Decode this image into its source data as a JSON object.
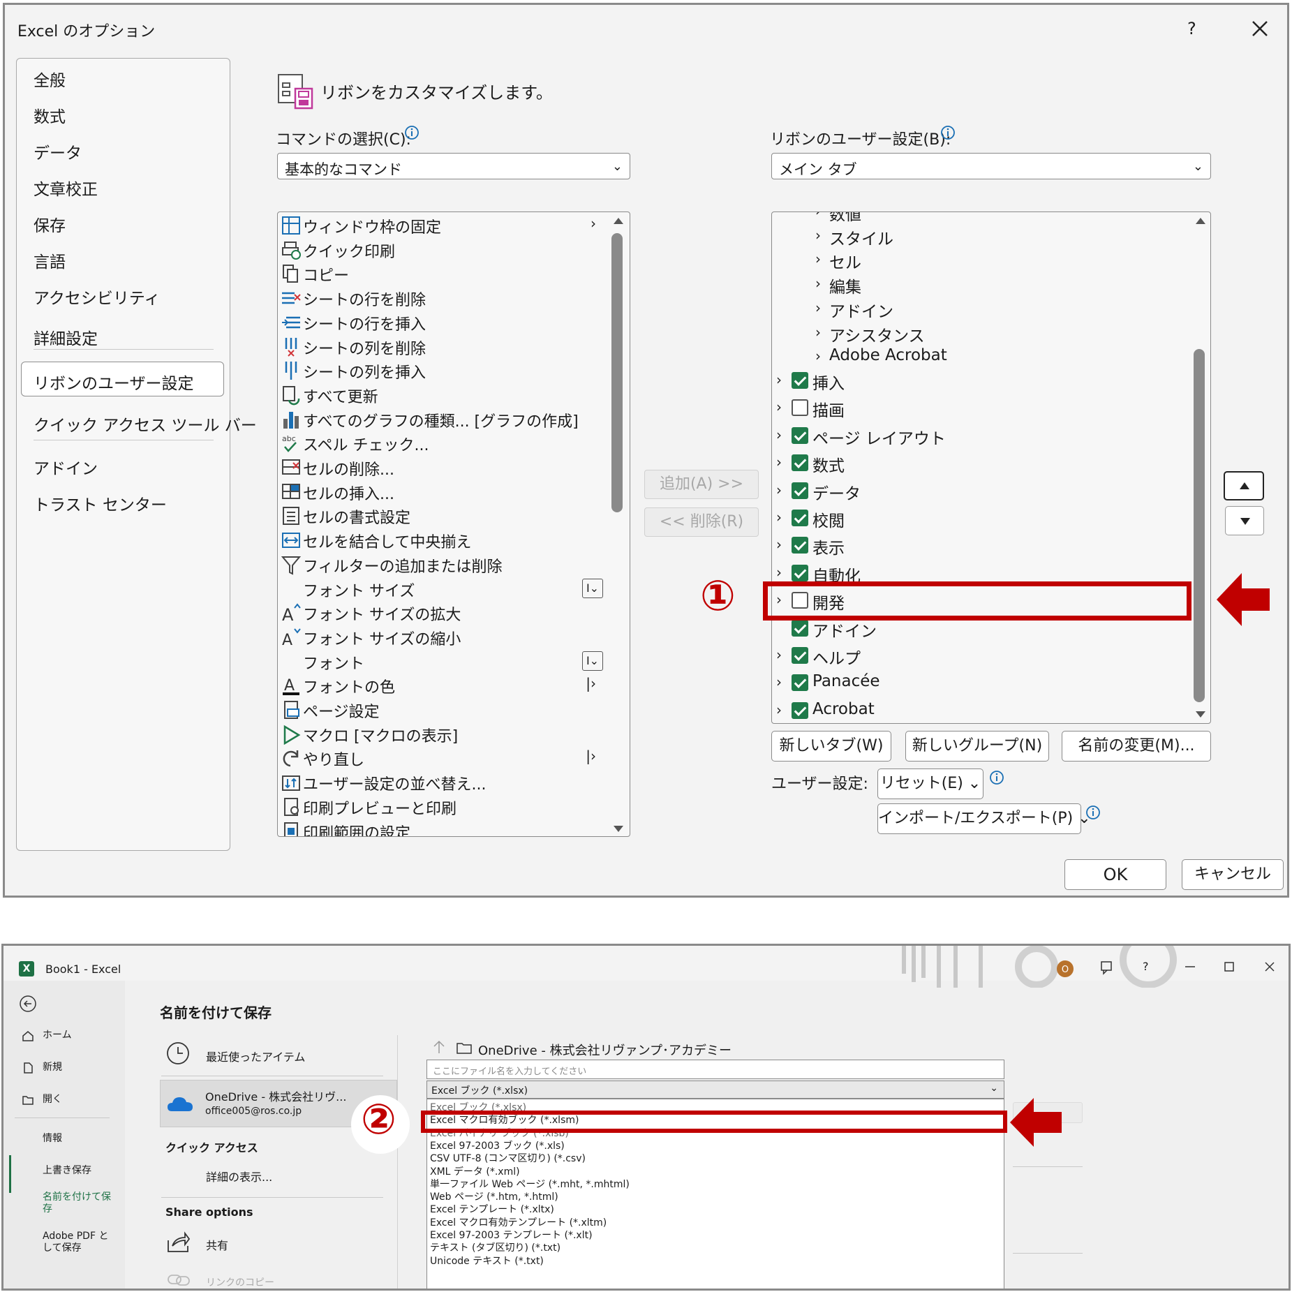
{
  "dialog": {
    "title": "Excel のオプション",
    "help": "?",
    "nav": [
      "全般",
      "数式",
      "データ",
      "文章校正",
      "保存",
      "言語",
      "アクセシビリティ",
      "詳細設定",
      "リボンのユーザー設定",
      "クイック アクセス ツール バー",
      "アドイン",
      "トラスト センター"
    ],
    "selected_nav": "リボンのユーザー設定",
    "heading": "リボンをカスタマイズします。",
    "commands_label": "コマンドの選択(C):",
    "commands_value": "基本的なコマンド",
    "ribbon_label": "リボンのユーザー設定(B):",
    "ribbon_value": "メイン タブ",
    "commands": [
      {
        "label": "ウィンドウ枠の固定",
        "icon": "freeze-panes-icon",
        "suffix": "arrow"
      },
      {
        "label": "クイック印刷",
        "icon": "quick-print-icon"
      },
      {
        "label": "コピー",
        "icon": "copy-icon"
      },
      {
        "label": "シートの行を削除",
        "icon": "delete-rows-icon"
      },
      {
        "label": "シートの行を挿入",
        "icon": "insert-rows-icon"
      },
      {
        "label": "シートの列を削除",
        "icon": "delete-columns-icon"
      },
      {
        "label": "シートの列を挿入",
        "icon": "insert-columns-icon"
      },
      {
        "label": "すべて更新",
        "icon": "refresh-all-icon"
      },
      {
        "label": "すべてのグラフの種類... [グラフの作成]",
        "icon": "chart-icon"
      },
      {
        "label": "スペル チェック...",
        "icon": "spell-check-icon"
      },
      {
        "label": "セルの削除...",
        "icon": "delete-cells-icon"
      },
      {
        "label": "セルの挿入...",
        "icon": "insert-cells-icon"
      },
      {
        "label": "セルの書式設定",
        "icon": "format-cells-icon"
      },
      {
        "label": "セルを結合して中央揃え",
        "icon": "merge-center-icon"
      },
      {
        "label": "フィルターの追加または削除",
        "icon": "filter-icon"
      },
      {
        "label": "フォント サイズ",
        "icon": "",
        "suffix": "box"
      },
      {
        "label": "フォント サイズの拡大",
        "icon": "font-grow-icon"
      },
      {
        "label": "フォント サイズの縮小",
        "icon": "font-shrink-icon"
      },
      {
        "label": "フォント",
        "icon": "",
        "suffix": "box"
      },
      {
        "label": "フォントの色",
        "icon": "font-color-icon",
        "suffix": "split"
      },
      {
        "label": "ページ設定",
        "icon": "page-setup-icon"
      },
      {
        "label": "マクロ [マクロの表示]",
        "icon": "macro-play-icon"
      },
      {
        "label": "やり直し",
        "icon": "redo-icon",
        "suffix": "split"
      },
      {
        "label": "ユーザー設定の並べ替え...",
        "icon": "custom-sort-icon"
      },
      {
        "label": "印刷プレビューと印刷",
        "icon": "print-preview-icon"
      },
      {
        "label": "印刷範囲の設定",
        "icon": "print-area-icon"
      }
    ],
    "add_button": "追加(A) >>",
    "remove_button": "<< 削除(R)",
    "ribbon_groups": [
      "数値",
      "スタイル",
      "セル",
      "編集",
      "アドイン",
      "アシスタンス",
      "Adobe Acrobat"
    ],
    "ribbon_tabs": [
      {
        "label": "挿入",
        "checked": true,
        "expandable": true
      },
      {
        "label": "描画",
        "checked": false,
        "expandable": true
      },
      {
        "label": "ページ レイアウト",
        "checked": true,
        "expandable": true
      },
      {
        "label": "数式",
        "checked": true,
        "expandable": true
      },
      {
        "label": "データ",
        "checked": true,
        "expandable": true
      },
      {
        "label": "校閲",
        "checked": true,
        "expandable": true
      },
      {
        "label": "表示",
        "checked": true,
        "expandable": true
      },
      {
        "label": "自動化",
        "checked": true,
        "expandable": true
      },
      {
        "label": "開発",
        "checked": false,
        "expandable": true
      },
      {
        "label": "アドイン",
        "checked": true,
        "expandable": false
      },
      {
        "label": "ヘルプ",
        "checked": true,
        "expandable": true
      },
      {
        "label": "Panacée",
        "checked": true,
        "expandable": true
      },
      {
        "label": "Acrobat",
        "checked": true,
        "expandable": true
      }
    ],
    "new_tab": "新しいタブ(W)",
    "new_group": "新しいグループ(N)",
    "rename": "名前の変更(M)...",
    "user_settings_label": "ユーザー設定:",
    "reset": "リセット(E) ⌄",
    "import_export": "インポート/エクスポート(P) ⌄",
    "ok": "OK",
    "cancel": "キャンセル",
    "marker1": "①",
    "accent_color": "#c00000",
    "check_color": "#1f7a4a"
  },
  "saveas": {
    "window_title": "Book1 - Excel",
    "app_icon": "X",
    "avatar_initial": "O",
    "help": "?",
    "heading": "名前を付けて保存",
    "side_nav": [
      {
        "label": "ホーム",
        "icon": "home-icon"
      },
      {
        "label": "新規",
        "icon": "new-file-icon"
      },
      {
        "label": "開く",
        "icon": "open-folder-icon"
      },
      {
        "label": "情報"
      },
      {
        "label": "上書き保存"
      },
      {
        "label": "名前を付けて保存"
      },
      {
        "label": "Adobe PDF として保存"
      }
    ],
    "recent": "最近使ったアイテム",
    "onedrive_name": "OneDrive - 株式会社リヴ...",
    "onedrive_email": "office005@ros.co.jp",
    "quick_access": "クイック アクセス",
    "show_more": "詳細の表示...",
    "share_options": "Share options",
    "share": "共有",
    "copy_link": "リンクのコピー",
    "path": "OneDrive - 株式会社リヴァンプ･アカデミー",
    "filename_placeholder": "ここにファイル名を入力してください",
    "file_type": "Excel ブック (*.xlsx)",
    "file_types": [
      "Excel ブック (*.xlsx)",
      "Excel マクロ有効ブック (*.xlsm)",
      "Excel バイナリ ブック (*.xlsb)",
      "Excel 97-2003 ブック (*.xls)",
      "CSV UTF-8 (コンマ区切り) (*.csv)",
      "XML データ (*.xml)",
      "単一ファイル Web ページ (*.mht, *.mhtml)",
      "Web ページ (*.htm, *.html)",
      "Excel テンプレート (*.xltx)",
      "Excel マクロ有効テンプレート (*.xltm)",
      "Excel 97-2003 テンプレート (*.xlt)",
      "テキスト (タブ区切り) (*.txt)",
      "Unicode テキスト (*.txt)"
    ],
    "marker2": "②"
  }
}
